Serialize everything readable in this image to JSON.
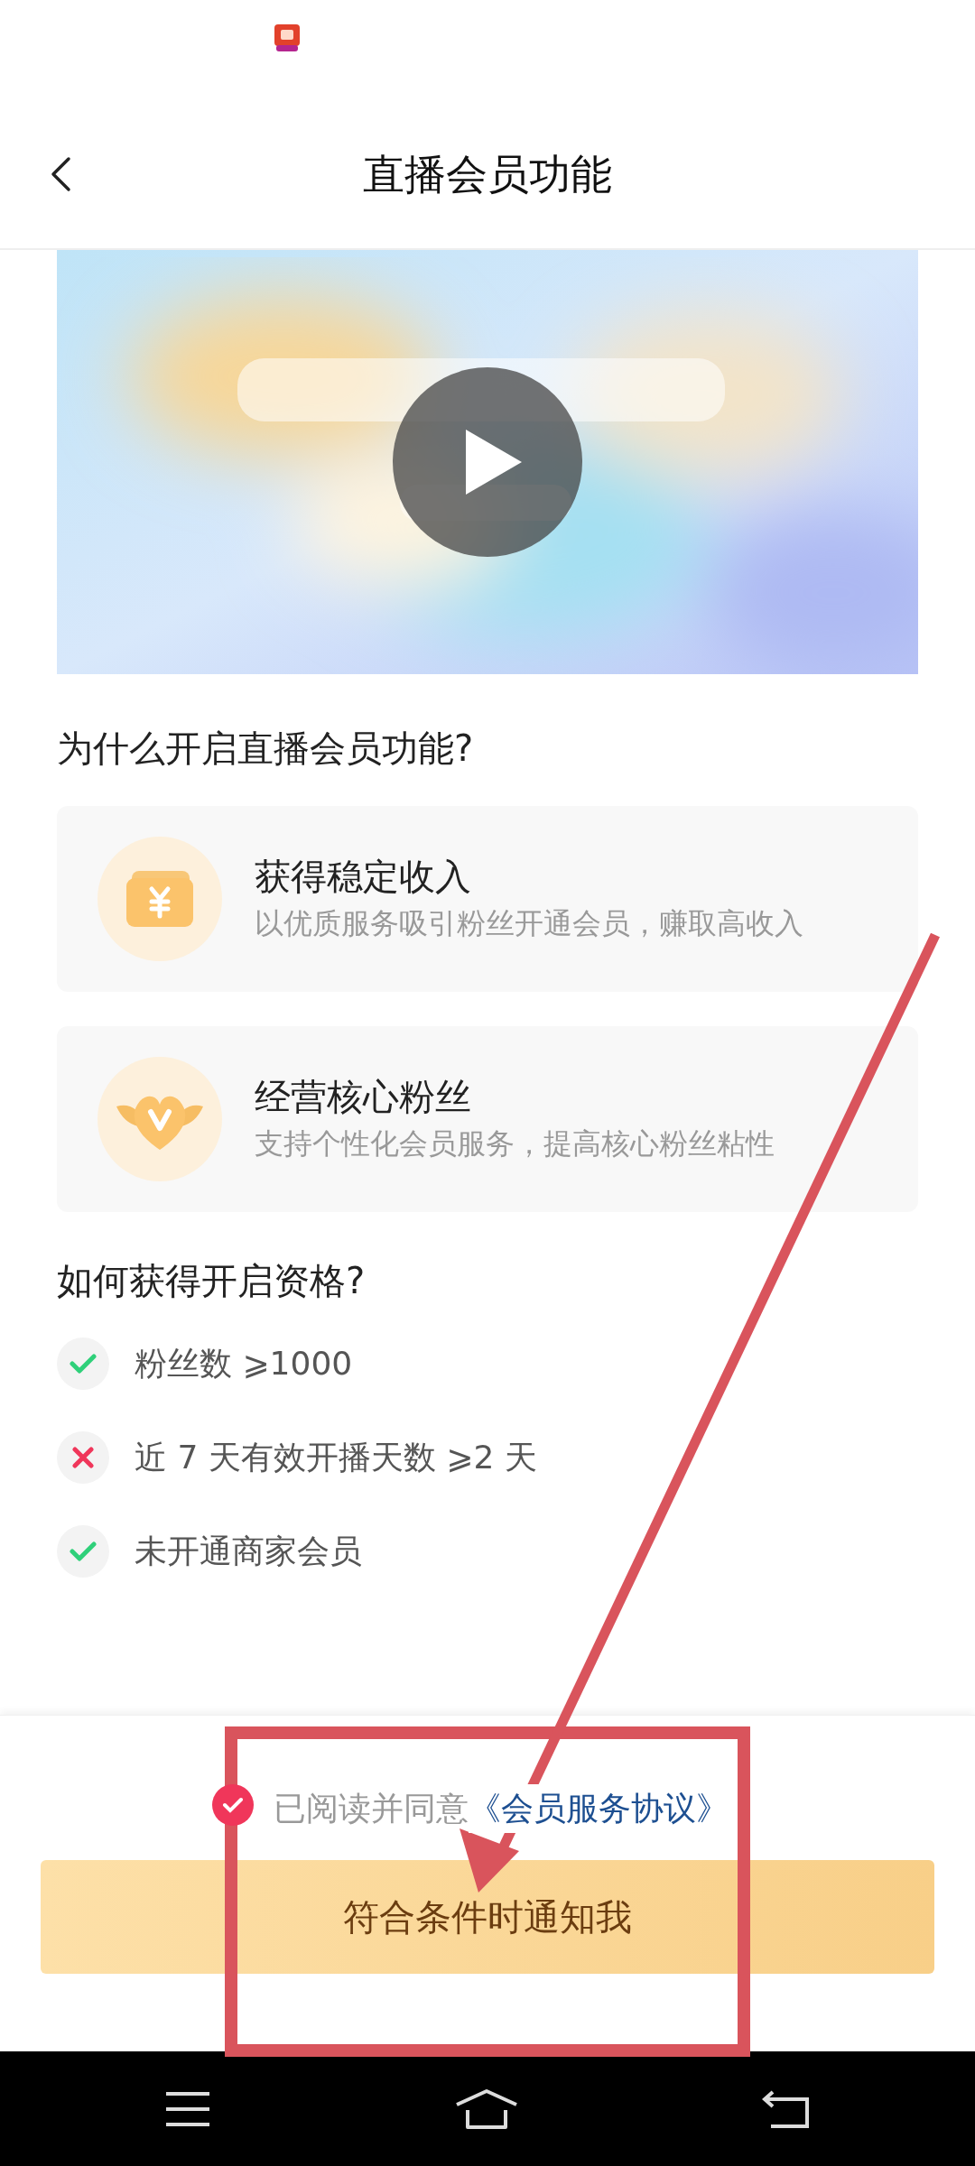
{
  "header": {
    "title": "直播会员功能"
  },
  "why": {
    "heading": "为什么开启直播会员功能?",
    "benefits": [
      {
        "title": "获得稳定收入",
        "subtitle": "以优质服务吸引粉丝开通会员，赚取高收入"
      },
      {
        "title": "经营核心粉丝",
        "subtitle": "支持个性化会员服务，提高核心粉丝粘性"
      }
    ]
  },
  "requirements": {
    "heading": "如何获得开启资格?",
    "items": [
      {
        "text": "粉丝数 ⩾1000",
        "met": true
      },
      {
        "text": "近 7 天有效开播天数 ⩾2 天",
        "met": false
      },
      {
        "text": "未开通商家会员",
        "met": true
      }
    ]
  },
  "agreement": {
    "checked": true,
    "text": "已阅读并同意",
    "link": "《会员服务协议》"
  },
  "button": {
    "label": "符合条件时通知我"
  }
}
